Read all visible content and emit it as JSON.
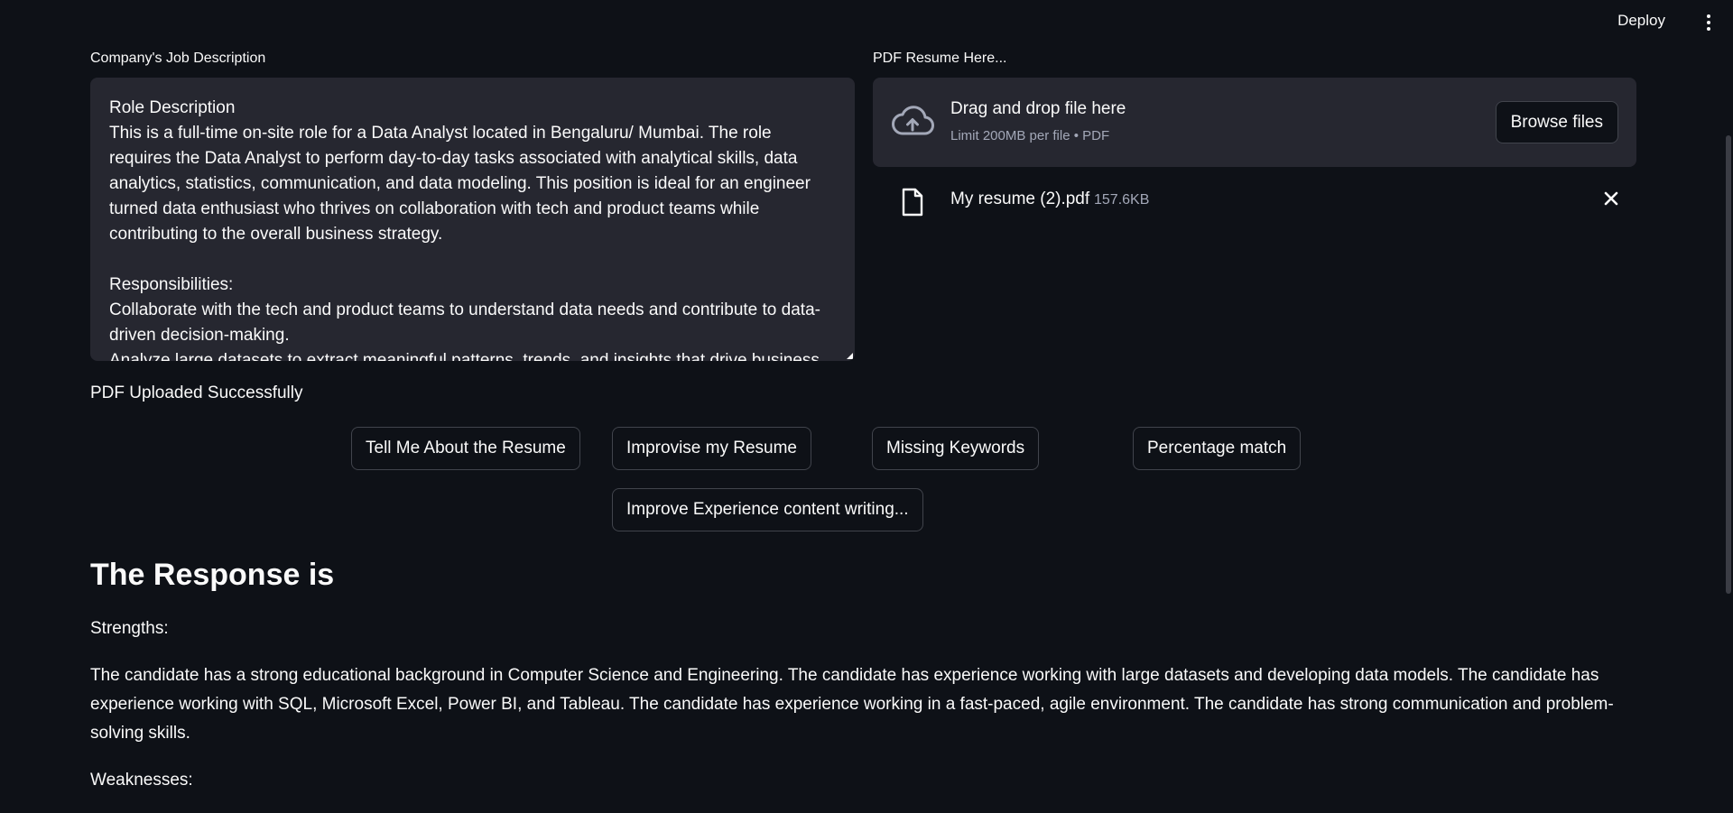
{
  "topbar": {
    "deploy_label": "Deploy"
  },
  "job_description": {
    "label": "Company's Job Description",
    "text": "Role Description\nThis is a full-time on-site role for a Data Analyst located in Bengaluru/ Mumbai. The role requires the Data Analyst to perform day-to-day tasks associated with analytical skills, data analytics, statistics, communication, and data modeling. This position is ideal for an engineer turned data enthusiast who thrives on collaboration with tech and product teams while contributing to the overall business strategy.\n\nResponsibilities:\nCollaborate with the tech and product teams to understand data needs and contribute to data-driven decision-making.\nAnalyze large datasets to extract meaningful patterns, trends, and insights that drive business"
  },
  "uploader": {
    "label": "PDF Resume Here...",
    "dropzone_title": "Drag and drop file here",
    "dropzone_limit": "Limit 200MB per file • PDF",
    "browse_label": "Browse files",
    "file": {
      "name": "My resume (2).pdf",
      "size": "157.6KB"
    }
  },
  "status_message": "PDF Uploaded Successfully",
  "actions": {
    "tell_me": "Tell Me About the Resume",
    "improvise": "Improvise my Resume",
    "missing_keywords": "Missing Keywords",
    "percentage_match": "Percentage match",
    "improve_experience": "Improve Experience content writing..."
  },
  "response": {
    "title": "The Response is",
    "strengths_heading": "Strengths:",
    "strengths_text": "The candidate has a strong educational background in Computer Science and Engineering. The candidate has experience working with large datasets and developing data models. The candidate has experience working with SQL, Microsoft Excel, Power BI, and Tableau. The candidate has experience working in a fast-paced, agile environment. The candidate has strong communication and problem-solving skills.",
    "weaknesses_heading": "Weaknesses:"
  },
  "colors": {
    "background": "#0e1117",
    "input_background": "#262730",
    "text": "#fafafa",
    "muted_text": "#a3a8b8",
    "button_border": "#41444c"
  }
}
